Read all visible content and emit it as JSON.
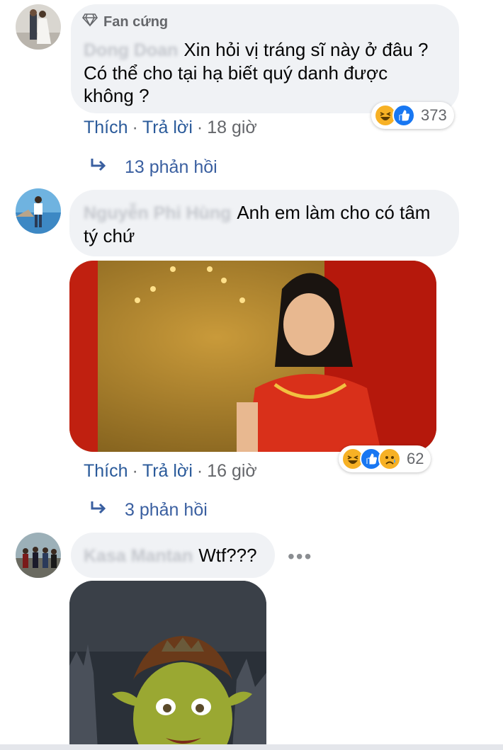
{
  "comments": [
    {
      "badge": "Fan cứng",
      "author": "Dong Doan",
      "text_line1": "Xin hỏi vị tráng sĩ này ở đâu ?",
      "text_line2": "Có thể cho tại hạ biết quý danh được",
      "text_line3": "không ?",
      "like_label": "Thích",
      "reply_label": "Trả lời",
      "time": "18 giờ",
      "reaction_count": "373",
      "reactions": [
        "haha-icon",
        "like-icon"
      ],
      "replies_label": "13 phản hồi"
    },
    {
      "author": "Nguyễn Phi Hùng",
      "text_line1": "Anh em làm cho có tâm",
      "text_line2": "tý chứ",
      "like_label": "Thích",
      "reply_label": "Trả lời",
      "time": "16 giờ",
      "reaction_count": "62",
      "reactions": [
        "haha-icon",
        "like-icon",
        "sad-icon"
      ],
      "replies_label": "3 phản hồi"
    },
    {
      "author": "Kasa Mantan",
      "text_line1": "Wtf???",
      "more_label": "•••"
    }
  ],
  "colors": {
    "link": "#2a5a9a",
    "bubble": "#f0f2f5",
    "meta": "#65676b",
    "like": "#1877f2",
    "haha": "#f7b125"
  }
}
